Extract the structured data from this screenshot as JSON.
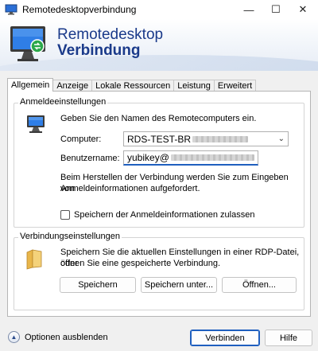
{
  "window": {
    "title": "Remotedesktopverbindung",
    "controls": [
      "—",
      "☐",
      "✕"
    ]
  },
  "banner": {
    "line1": "Remotedesktop",
    "line2": "Verbindung"
  },
  "tabs": [
    {
      "label": "Allgemein",
      "active": true
    },
    {
      "label": "Anzeige",
      "active": false
    },
    {
      "label": "Lokale Ressourcen",
      "active": false
    },
    {
      "label": "Leistung",
      "active": false
    },
    {
      "label": "Erweitert",
      "active": false
    }
  ],
  "logon": {
    "group_label": "Anmeldeeinstellungen",
    "intro": "Geben Sie den Namen des Remotecomputers ein.",
    "computer_label": "Computer:",
    "computer_value": "RDS-TEST-BR",
    "username_label": "Benutzername:",
    "username_value": "yubikey@",
    "info_line1": "Beim Herstellen der Verbindung werden Sie zum Eingeben von",
    "info_line2": "Anmeldeinformationen aufgefordert.",
    "save_credentials_label": "Speichern der Anmeldeinformationen zulassen",
    "save_credentials_checked": false
  },
  "connection": {
    "group_label": "Verbindungseinstellungen",
    "desc_line1": "Speichern Sie die aktuellen Einstellungen in einer RDP-Datei, oder",
    "desc_line2": "öffnen Sie eine gespeicherte Verbindung.",
    "save_label": "Speichern",
    "save_as_label": "Speichern unter...",
    "open_label": "Öffnen..."
  },
  "footer": {
    "options_label": "Optionen ausblenden",
    "connect_label": "Verbinden",
    "help_label": "Hilfe"
  },
  "colors": {
    "accent": "#1f5fbf",
    "banner_text": "#1a3a8a",
    "window_bg": "#f0f0f0"
  }
}
